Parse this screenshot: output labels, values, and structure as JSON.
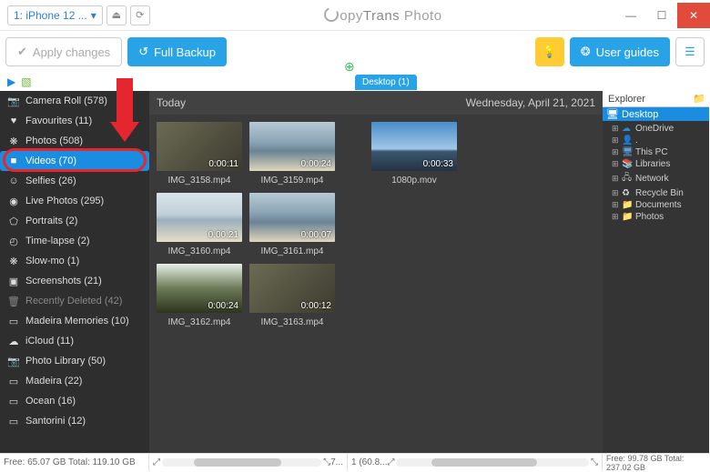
{
  "title_prefix": "opy",
  "title_main": "Trans",
  "title_suffix": " Photo",
  "device_label": "1: iPhone 12 ...",
  "toolbar": {
    "apply_label": "Apply changes",
    "backup_label": "Full Backup",
    "guides_label": "User guides"
  },
  "sidebar": [
    {
      "icon": "📷",
      "label": "Camera Roll (578)"
    },
    {
      "icon": "♥",
      "label": "Favourites (11)"
    },
    {
      "icon": "❋",
      "label": "Photos (508)"
    },
    {
      "icon": "■",
      "label": "Videos (70)",
      "selected": true
    },
    {
      "icon": "☺",
      "label": "Selfies (26)"
    },
    {
      "icon": "◉",
      "label": "Live Photos (295)"
    },
    {
      "icon": "⬠",
      "label": "Portraits (2)"
    },
    {
      "icon": "◴",
      "label": "Time-lapse (2)"
    },
    {
      "icon": "❋",
      "label": "Slow-mo (1)"
    },
    {
      "icon": "▣",
      "label": "Screenshots (21)"
    },
    {
      "icon": "🗑",
      "label": "Recently Deleted (42)",
      "muted": true
    },
    {
      "icon": "▭",
      "label": "Madeira Memories (10)"
    },
    {
      "icon": "☁",
      "label": "iCloud (11)"
    },
    {
      "icon": "📷",
      "label": "Photo Library (50)"
    },
    {
      "icon": "▭",
      "label": "Madeira (22)"
    },
    {
      "icon": "▭",
      "label": "Ocean (16)"
    },
    {
      "icon": "▭",
      "label": "Santorini (12)"
    }
  ],
  "left_panel": {
    "header": "Today",
    "thumbs": [
      {
        "dur": "0:00:11",
        "name": "IMG_3158.mp4",
        "cls": ""
      },
      {
        "dur": "0:00:24",
        "name": "IMG_3159.mp4",
        "cls": "sea"
      },
      {
        "dur": "0:00:21",
        "name": "IMG_3160.mp4",
        "cls": "beach"
      },
      {
        "dur": "0:00:07",
        "name": "IMG_3161.mp4",
        "cls": "sea"
      },
      {
        "dur": "0:00:24",
        "name": "IMG_3162.mp4",
        "cls": "forest"
      },
      {
        "dur": "0:00:12",
        "name": "IMG_3163.mp4",
        "cls": ""
      }
    ]
  },
  "mid_panel": {
    "tab_label": "Desktop (1)",
    "header": "Wednesday, April 21, 2021",
    "thumbs": [
      {
        "dur": "0:00:33",
        "name": "1080p.mov",
        "cls": "sky"
      }
    ]
  },
  "explorer": {
    "head": "Explorer",
    "root": "Desktop",
    "items": [
      {
        "icon": "☁",
        "color": "#2a8ad4",
        "label": "OneDrive"
      },
      {
        "icon": "👤",
        "color": "#bbb",
        "label": "."
      },
      {
        "icon": "🖥",
        "color": "#5ea0d8",
        "label": "This PC"
      },
      {
        "icon": "📚",
        "color": "#e0b020",
        "label": "Libraries"
      },
      {
        "icon": "🖧",
        "color": "#bbb",
        "label": "Network"
      },
      {
        "icon": "♻",
        "color": "#ddd",
        "label": "Recycle Bin"
      },
      {
        "icon": "📁",
        "color": "#e0b020",
        "label": "Documents"
      },
      {
        "icon": "📁",
        "color": "#e0b020",
        "label": "Photos"
      }
    ]
  },
  "status": {
    "left": "Free: 65.07 GB Total: 119.10 GB",
    "mid1": "7...",
    "mid2": "1 (60.8...",
    "right": "Free: 99.78 GB Total: 237.02 GB"
  }
}
